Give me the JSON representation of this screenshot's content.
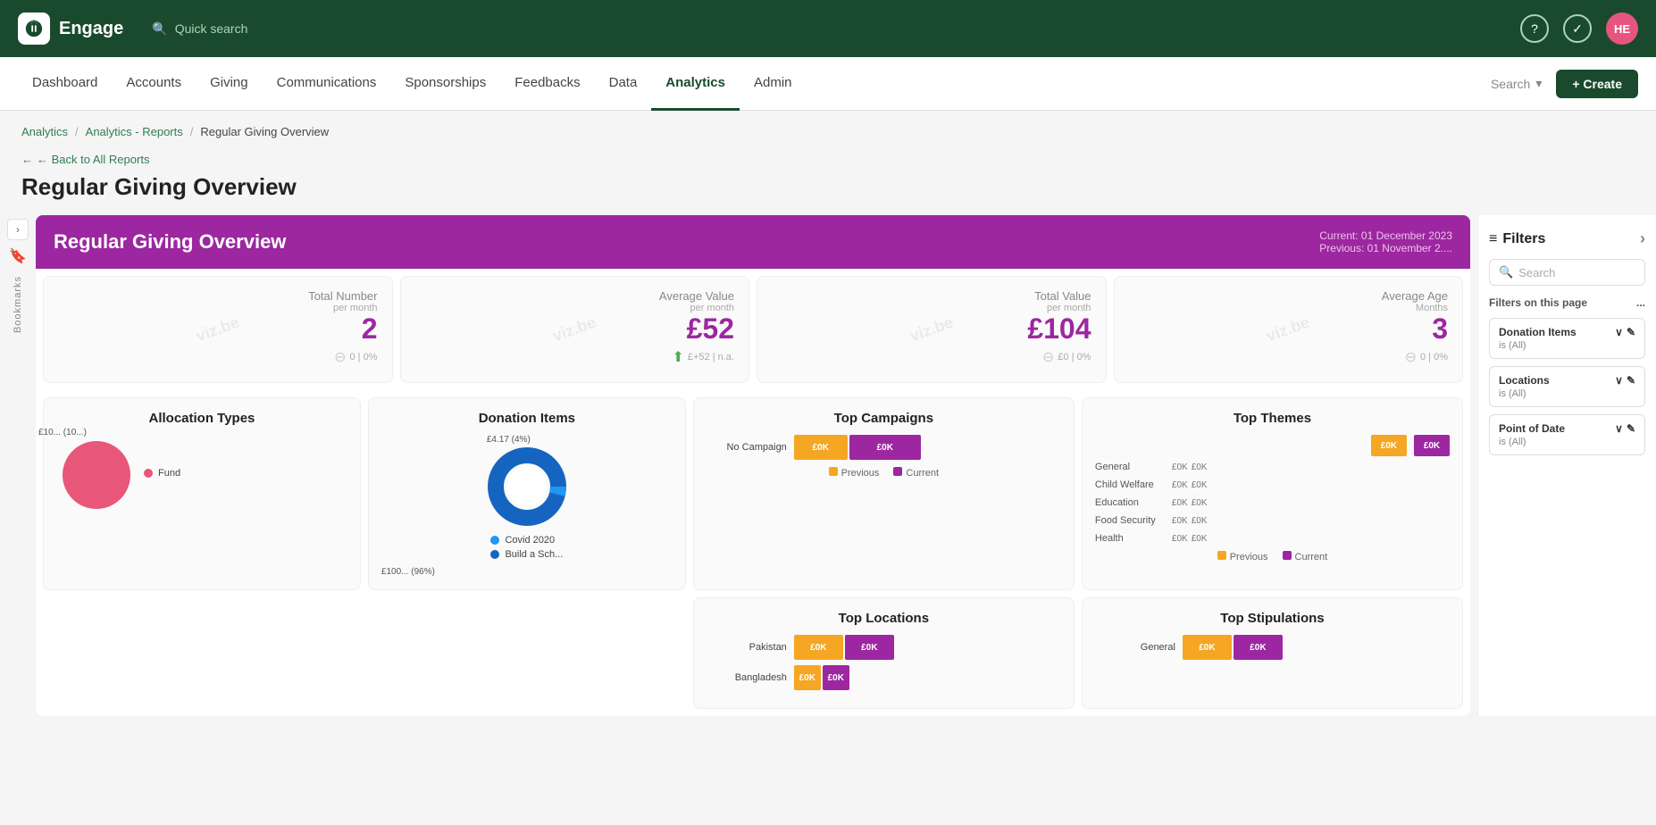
{
  "app": {
    "name": "Engage",
    "search_placeholder": "Quick search"
  },
  "top_nav": {
    "help_icon": "?",
    "check_icon": "✓",
    "avatar_initials": "HE"
  },
  "nav": {
    "items": [
      {
        "label": "Dashboard",
        "active": false
      },
      {
        "label": "Accounts",
        "active": false
      },
      {
        "label": "Giving",
        "active": false
      },
      {
        "label": "Communications",
        "active": false
      },
      {
        "label": "Sponsorships",
        "active": false
      },
      {
        "label": "Feedbacks",
        "active": false
      },
      {
        "label": "Data",
        "active": false
      },
      {
        "label": "Analytics",
        "active": true
      },
      {
        "label": "Admin",
        "active": false
      }
    ],
    "search_label": "Search",
    "create_label": "+ Create"
  },
  "breadcrumb": {
    "items": [
      {
        "label": "Analytics",
        "link": true
      },
      {
        "label": "Analytics - Reports",
        "link": true
      },
      {
        "label": "Regular Giving Overview",
        "link": false
      }
    ]
  },
  "page": {
    "back_label": "← Back to All Reports",
    "title": "Regular Giving Overview"
  },
  "report": {
    "title": "Regular Giving Overview",
    "current_date": "Current:  01 December 2023",
    "previous_date": "Previous: 01 November 2....",
    "stats": [
      {
        "label": "Total Number",
        "sub_label": "per month",
        "value": "2",
        "change": "0 | 0%",
        "icon": "♥"
      },
      {
        "label": "Average Value",
        "sub_label": "per month",
        "value": "£52",
        "change": "£+52 | n.a.",
        "icon": "👤",
        "has_up_arrow": true
      },
      {
        "label": "Total Value",
        "sub_label": "per month",
        "value": "£104",
        "change": "£0 | 0%",
        "icon": "♥"
      },
      {
        "label": "Average Age",
        "sub_label": "Months",
        "value": "3",
        "change": "0 | 0%",
        "icon": "📊"
      }
    ],
    "top_campaigns": {
      "title": "Top Campaigns",
      "bars": [
        {
          "label": "No Campaign",
          "prev_val": "£0K",
          "curr_val": "£0K",
          "prev_w": 60,
          "curr_w": 80
        },
        {
          "label": "",
          "prev_val": "",
          "curr_val": "",
          "prev_w": 0,
          "curr_w": 0
        }
      ],
      "legend_previous": "Previous",
      "legend_current": "Current"
    },
    "top_themes": {
      "title": "Top Themes",
      "header_prev": "£0K",
      "header_curr": "£0K",
      "rows": [
        {
          "label": "General",
          "prev": "£0K",
          "curr": "£0K"
        },
        {
          "label": "Child Welfare",
          "prev": "£0K",
          "curr": "£0K"
        },
        {
          "label": "Education",
          "prev": "£0K",
          "curr": "£0K"
        },
        {
          "label": "Food Security",
          "prev": "£0K",
          "curr": "£0K"
        },
        {
          "label": "Health",
          "prev": "£0K",
          "curr": "£0K"
        }
      ],
      "legend_previous": "Previous",
      "legend_current": "Current"
    },
    "allocation_types": {
      "title": "Allocation Types",
      "legend": [
        {
          "label": "Fund",
          "color": "#e8567a"
        }
      ],
      "pie_label": "£10... (10...)"
    },
    "donation_items": {
      "title": "Donation Items",
      "segments": [
        {
          "label": "Covid 2020",
          "color": "#2196f3",
          "value": "£4.17 (4%)"
        },
        {
          "label": "Build a Sch...",
          "color": "#1565c0",
          "value": "£100... (96%)"
        }
      ]
    },
    "top_locations": {
      "title": "Top Locations",
      "rows": [
        {
          "label": "Pakistan",
          "prev": "£0K",
          "curr": "£0K"
        },
        {
          "label": "Bangladesh",
          "prev": "£0K",
          "curr": "£0K"
        }
      ]
    },
    "top_stipulations": {
      "title": "Top Stipulations",
      "rows": [
        {
          "label": "General",
          "prev": "£0K",
          "curr": "£0K"
        }
      ]
    }
  },
  "filters": {
    "title": "Filters",
    "search_placeholder": "Search",
    "on_page_label": "Filters on this page",
    "on_page_dots": "...",
    "items": [
      {
        "label": "Donation Items",
        "sub": "is (All)"
      },
      {
        "label": "Locations",
        "sub": "is (All)"
      },
      {
        "label": "Point of Date",
        "sub": "is (All)"
      }
    ]
  }
}
